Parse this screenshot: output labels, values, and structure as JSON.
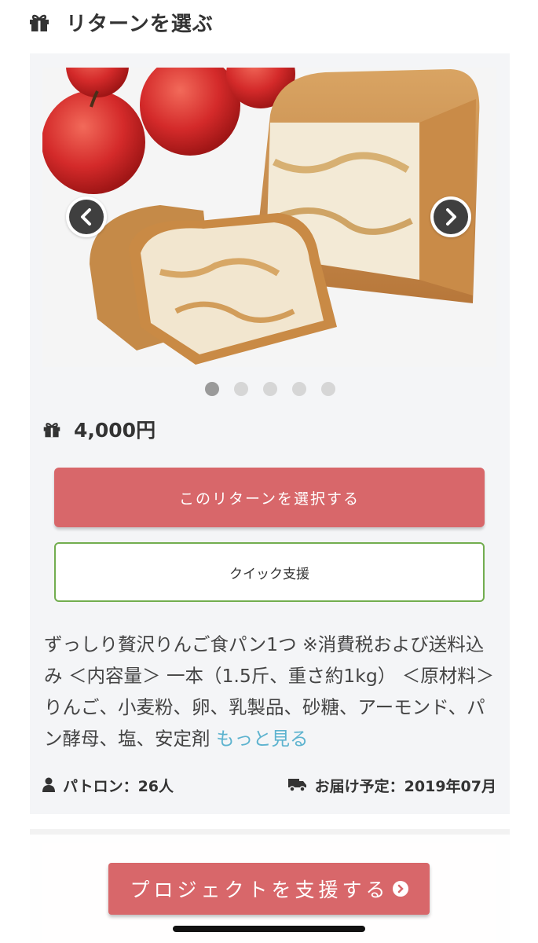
{
  "header": {
    "title": "リターンを選ぶ",
    "icon": "gift-icon"
  },
  "return_card": {
    "carousel": {
      "slide_count": 5,
      "active_index": 0,
      "prev_icon": "chevron-left-icon",
      "next_icon": "chevron-right-icon"
    },
    "price": "4,000円",
    "select_button_label": "このリターンを選択する",
    "quick_button_label": "クイック支援",
    "description": "ずっしり贅沢りんご食パン1つ ※消費税および送料込み ＜内容量＞ 一本（1.5斤、重さ約1kg） ＜原材料＞ りんご、小麦粉、卵、乳製品、砂糖、アーモンド、パン酵母、塩、安定剤",
    "more_link": "もっと見る",
    "patrons_text": "パトロン：26人",
    "delivery_text": "お届け予定：2019年07月"
  },
  "footer": {
    "cta_label": "プロジェクトを支援する"
  },
  "colors": {
    "accent": "#d8676a",
    "quick_border": "#72ad4f",
    "link": "#5db3cf",
    "card_bg": "#f4f5f7"
  }
}
